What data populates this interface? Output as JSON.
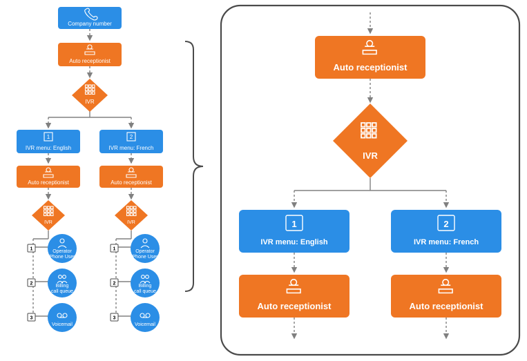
{
  "colors": {
    "blue": "#2b8ee6",
    "orange": "#ef7623",
    "stroke": "#4a4a4a",
    "connector": "#808080"
  },
  "mini": {
    "company_number": "Company number",
    "auto_receptionist": "Auto receptionist",
    "ivr": "IVR",
    "left": {
      "menu": "IVR menu: English",
      "auto_receptionist": "Auto receptionist",
      "ivr": "IVR",
      "key1": "1",
      "options": [
        {
          "key": "1",
          "line1": "Operator",
          "line2": "(Phone User)"
        },
        {
          "key": "2",
          "line1": "Billing",
          "line2": "call queue"
        },
        {
          "key": "3",
          "line1": "Voicemail",
          "line2": ""
        }
      ]
    },
    "right": {
      "menu": "IVR menu: French",
      "auto_receptionist": "Auto receptionist",
      "ivr": "IVR",
      "key2": "2",
      "options": [
        {
          "key": "1",
          "line1": "Operator",
          "line2": "(Phone User)"
        },
        {
          "key": "2",
          "line1": "Billing",
          "line2": "call queue"
        },
        {
          "key": "3",
          "line1": "Voicemail",
          "line2": ""
        }
      ]
    }
  },
  "zoom": {
    "auto_receptionist": "Auto receptionist",
    "ivr": "IVR",
    "left": {
      "key": "1",
      "menu": "IVR menu: English",
      "auto_receptionist": "Auto receptionist"
    },
    "right": {
      "key": "2",
      "menu": "IVR menu: French",
      "auto_receptionist": "Auto receptionist"
    }
  }
}
